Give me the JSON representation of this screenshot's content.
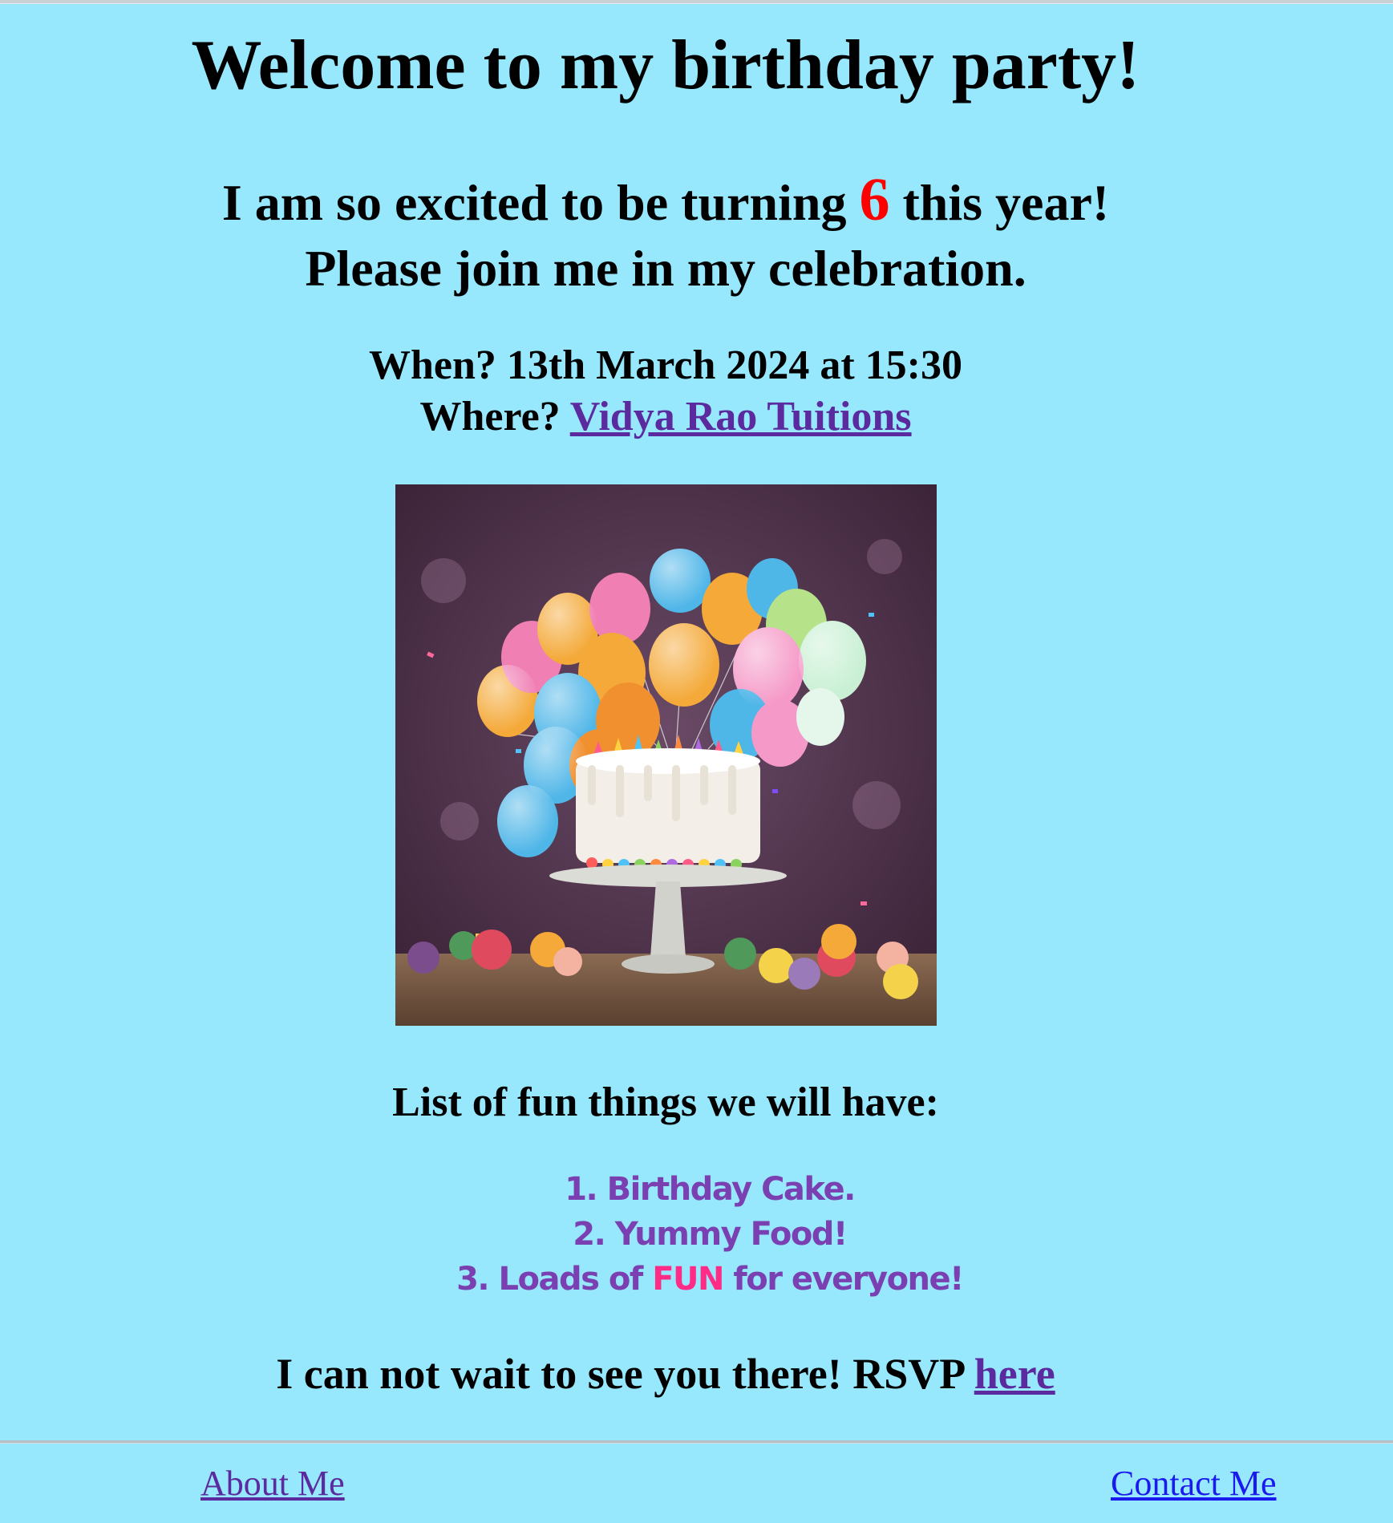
{
  "title": "Welcome to my birthday party!",
  "intro": {
    "line1_before": "I am so excited to be turning ",
    "age": "6",
    "line1_after": " this year!",
    "line2": "Please join me in my celebration."
  },
  "details": {
    "when": "When? 13th March 2024 at 15:30",
    "where_label": "Where? ",
    "where_link": "Vidya Rao Tuitions"
  },
  "list_heading": "List of fun things we will have:",
  "fun_list": {
    "item1": "1. Birthday Cake.",
    "item2": "2. Yummy Food!",
    "item3_before": "3. Loads of ",
    "item3_fun": "FUN",
    "item3_after": " for everyone!"
  },
  "closing": {
    "text": "I can not wait to see you there! RSVP ",
    "rsvp_link": "here"
  },
  "footer": {
    "about": "About Me",
    "contact": "Contact Me"
  },
  "colors": {
    "background": "#97e8fd",
    "age_highlight": "#ff0000",
    "list_text": "#7a3fb0",
    "fun_highlight": "#ff2b86",
    "visited_link": "#5a2a9e",
    "link": "#1a1aee"
  }
}
